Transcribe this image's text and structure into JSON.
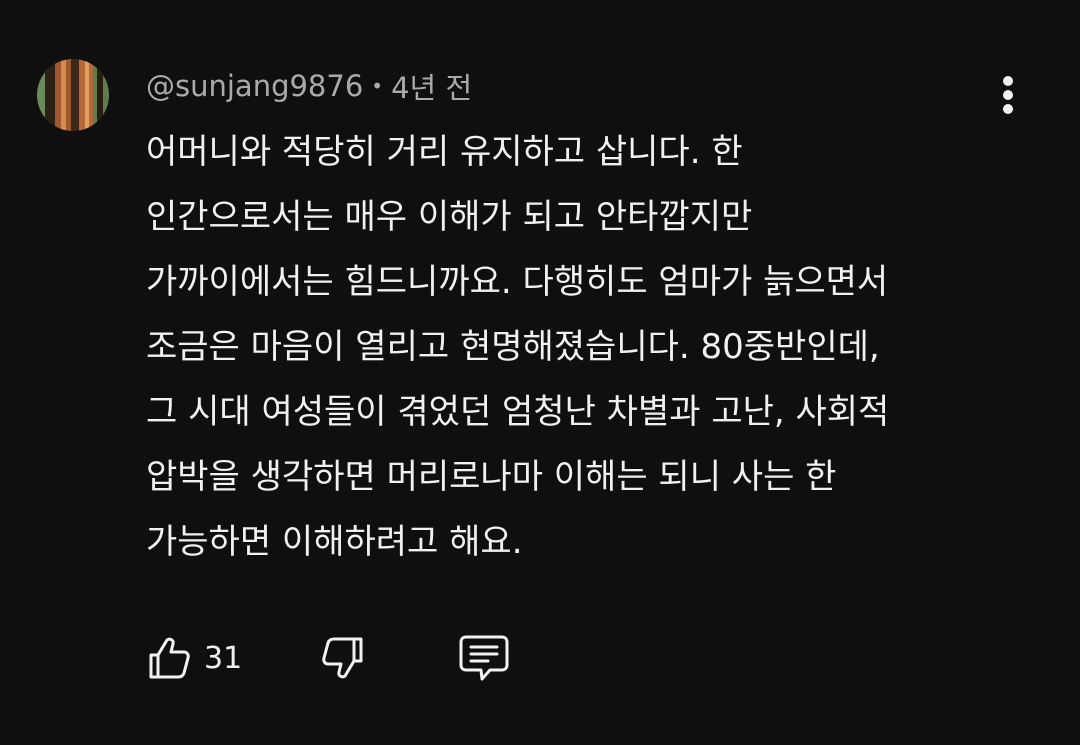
{
  "comment": {
    "author": "@sunjang9876",
    "separator": "•",
    "time": "4년 전",
    "text": "어머니와 적당히 거리 유지하고 삽니다. 한\n인간으로서는 매우 이해가 되고 안타깝지만\n가까이에서는 힘드니까요. 다행히도 엄마가 늙으면서\n조금은 마음이 열리고 현명해졌습니다. 80중반인데,\n그 시대 여성들이 겪었던 엄청난 차별과 고난, 사회적\n압박을 생각하면 머리로나마 이해는 되니 사는 한\n가능하면 이해하려고 해요.",
    "like_count": "31"
  },
  "icons": {
    "avatar": "tree-bark-photo",
    "more": "more-vertical-icon",
    "like": "thumbs-up-icon",
    "dislike": "thumbs-down-icon",
    "reply": "comment-icon"
  },
  "colors": {
    "background": "#0f0f0f",
    "text_primary": "#f1f1f1",
    "text_secondary": "#aaaaaa"
  }
}
